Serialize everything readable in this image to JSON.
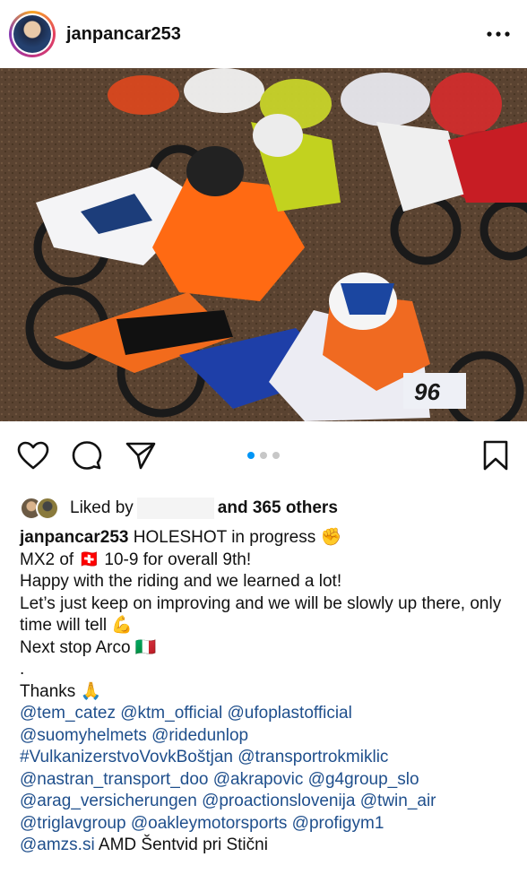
{
  "header": {
    "username": "janpancar253",
    "more_icon": "more-horizontal-icon"
  },
  "carousel": {
    "total": 3,
    "active": 1
  },
  "likes": {
    "prefix": "Liked by",
    "suffix": "and 365 others"
  },
  "caption": {
    "username": "janpancar253",
    "line1": "HOLESHOT in progress ✊",
    "line2": "MX2 of 🇨🇭 10-9 for overall 9th!",
    "line3": "Happy with the riding and we learned a lot!",
    "line4": "Let’s just keep on improving and we will be slowly up there, only time will tell 💪",
    "line5": "Next stop Arco 🇮🇹",
    "line6": ".",
    "line7": "Thanks 🙏",
    "tags": [
      [
        "@tem_catez",
        "@ktm_official",
        "@ufoplastofficial"
      ],
      [
        "@suomyhelmets",
        "@ridedunlop"
      ],
      [
        "#VulkanizerstvoVovkBoštjan",
        "@transportrokmiklic"
      ],
      [
        "@nastran_transport_doo",
        "@akrapovic",
        "@g4group_slo"
      ],
      [
        "@arag_versicherungen",
        "@proactionslovenija",
        "@twin_air"
      ],
      [
        "@triglavgroup",
        "@oakleymotorsports",
        "@profigym1"
      ],
      [
        "@amzs.si"
      ]
    ],
    "tail": "AMD Šentvid pri Stični"
  },
  "colors": {
    "link": "#1f4f8c",
    "active_dot": "#0095f6",
    "inactive_dot": "#c7c7c7"
  }
}
